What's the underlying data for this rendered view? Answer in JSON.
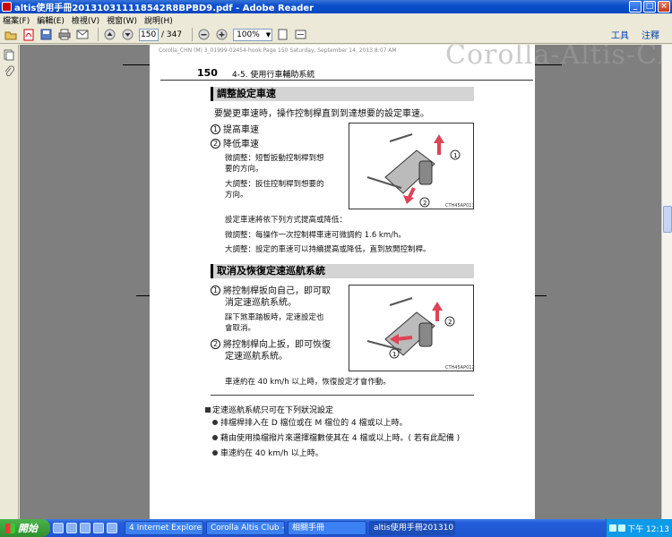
{
  "window": {
    "title": "altis使用手冊201310311118542R8BPBD9.pdf - Adobe Reader",
    "min": "_",
    "max": "□",
    "close": "×"
  },
  "menu": [
    "檔案(F)",
    "編輯(E)",
    "檢視(V)",
    "視窗(W)",
    "說明(H)"
  ],
  "toolbar": {
    "page_current": "150",
    "page_total": "/ 347",
    "zoom": "100%",
    "tools": "工具",
    "comment": "注釋"
  },
  "watermark": "Corolla-Altis-Club.tw",
  "page": {
    "header_meta": "Corolla_CHN (M) 3_01999-02454-hook   Page 150  Saturday, September 14, 2013   8:07 AM",
    "number": "150",
    "section": "4-5. 使用行車輔助系統",
    "s1": {
      "heading": "調整設定車速",
      "intro": "要變更車速時，操作控制桿直到到達想要的設定車速。",
      "item1_num": "1",
      "item1": "提高車速",
      "item2_num": "2",
      "item2": "降低車速",
      "fine_l1": "微調整：短暫扳動控制桿到想",
      "fine_l2": "要的方向。",
      "big_l1": "大調整：扳住控制桿到想要的",
      "big_l2": "方向。",
      "fig_caption": "CTH45AP011",
      "note1": "設定車速將依下列方式提高或降低：",
      "note2": "微調整：每操作一次控制桿車速可微調約 1.6 km/h。",
      "note3": "大調整：設定的車速可以持續提高或降低，直到放開控制桿。"
    },
    "s2": {
      "heading": "取消及恢復定速巡航系統",
      "item1_num": "1",
      "item1_l1": "將控制桿扳向自己，即可取",
      "item1_l2": "消定速巡航系統。",
      "brake_l1": "踩下煞車踏板時，定速設定也",
      "brake_l2": "會取消。",
      "item2_num": "2",
      "item2_l1": "將控制桿向上扳，即可恢復",
      "item2_l2": "定速巡航系統。",
      "fig_caption": "CTH45AP012",
      "note": "車速約在 40 km/h 以上時，恢復設定才會作動。"
    },
    "s3": {
      "heading": "定速巡航系統只可在下列狀況設定",
      "b1": "排檔桿排入在 D 檔位或在 M 檔位的 4 檔或以上時。",
      "b2": "藉由使用換檔撥片來選擇檔數使其在 4 檔或以上時。( 若有此配備 )",
      "b3": "車速約在 40 km/h 以上時。"
    }
  },
  "taskbar": {
    "start": "開始",
    "tasks": [
      "4 Internet Explorer",
      "Corolla Altis Club - P...",
      "相關手冊",
      "altis使用手冊201310..."
    ],
    "clock": "下午 12:13"
  },
  "colors": {
    "taskbar": "#245edb",
    "start": "#3c9a3c",
    "titlebar": "#0a4fcc"
  }
}
